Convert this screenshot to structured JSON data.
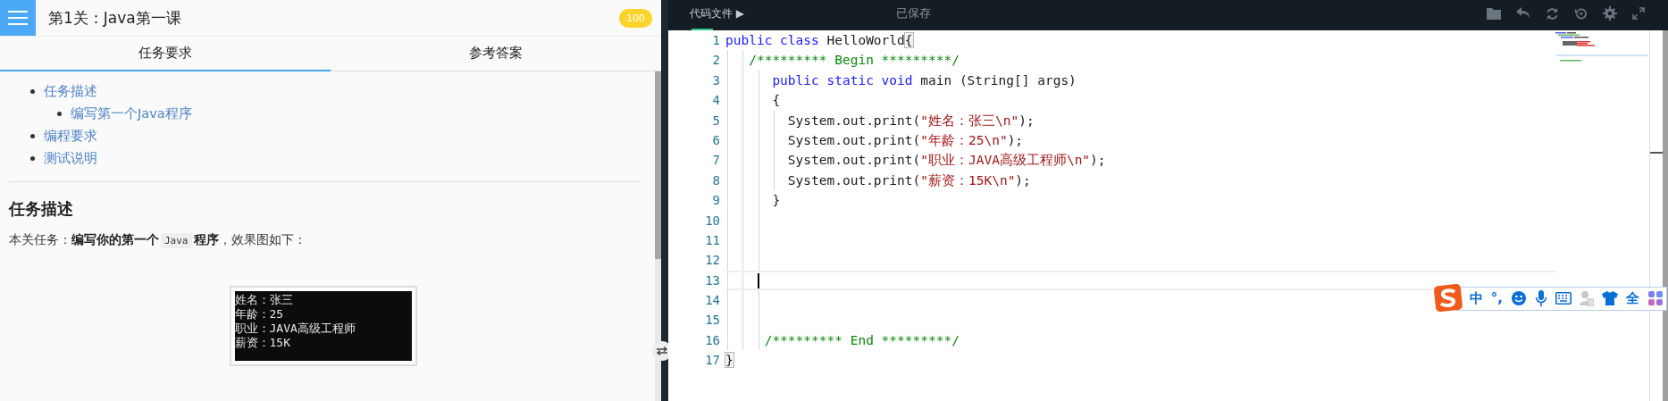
{
  "header": {
    "title": "第1关：Java第一课",
    "score": "100"
  },
  "tabs": [
    {
      "label": "任务要求",
      "selected": true
    },
    {
      "label": "参考答案",
      "selected": false
    }
  ],
  "toc": [
    {
      "label": "任务描述",
      "children": [
        {
          "label": "编写第一个Java程序"
        }
      ]
    },
    {
      "label": "编程要求"
    },
    {
      "label": "测试说明"
    }
  ],
  "section": {
    "heading": "任务描述",
    "paragraph": [
      {
        "kind": "text",
        "text": "本关任务："
      },
      {
        "kind": "bold",
        "text": "编写你的第一个"
      },
      {
        "kind": "code",
        "text": "Java"
      },
      {
        "kind": "bold",
        "text": "程序"
      },
      {
        "kind": "text",
        "text": "，效果图如下："
      }
    ]
  },
  "console_output": [
    "姓名：张三",
    "年龄：25",
    "职业：JAVA高级工程师",
    "薪资：15K"
  ],
  "editor": {
    "file_tab": "代码文件",
    "file_tab_arrow": "▶",
    "status": "已保存",
    "lines": [
      {
        "number": "1",
        "current": false,
        "tokens": [
          {
            "kind": "keyword",
            "text": "public class"
          },
          {
            "kind": "plain",
            "text": " HelloWorld"
          },
          {
            "kind": "match",
            "text": "{"
          }
        ]
      },
      {
        "number": "2",
        "current": false,
        "tokens": [
          {
            "kind": "comment",
            "text": "   /********* Begin *********/"
          }
        ]
      },
      {
        "number": "3",
        "current": false,
        "tokens": [
          {
            "kind": "keyword",
            "text": "      public static void"
          },
          {
            "kind": "plain",
            "text": " main (String[] args)"
          }
        ]
      },
      {
        "number": "4",
        "current": false,
        "tokens": [
          {
            "kind": "plain",
            "text": "      {"
          }
        ]
      },
      {
        "number": "5",
        "current": false,
        "tokens": [
          {
            "kind": "plain",
            "text": "        System.out.print("
          },
          {
            "kind": "string",
            "text": "\"姓名：张三\\n\""
          },
          {
            "kind": "plain",
            "text": ");"
          }
        ]
      },
      {
        "number": "6",
        "current": false,
        "tokens": [
          {
            "kind": "plain",
            "text": "        System.out.print("
          },
          {
            "kind": "string",
            "text": "\"年龄：25\\n\""
          },
          {
            "kind": "plain",
            "text": ");"
          }
        ]
      },
      {
        "number": "7",
        "current": false,
        "tokens": [
          {
            "kind": "plain",
            "text": "        System.out.print("
          },
          {
            "kind": "string",
            "text": "\"职业：JAVA高级工程师\\n\""
          },
          {
            "kind": "plain",
            "text": ");"
          }
        ]
      },
      {
        "number": "8",
        "current": false,
        "tokens": [
          {
            "kind": "plain",
            "text": "        System.out.print("
          },
          {
            "kind": "string",
            "text": "\"薪资：15K\\n\""
          },
          {
            "kind": "plain",
            "text": ");"
          }
        ]
      },
      {
        "number": "9",
        "current": false,
        "tokens": [
          {
            "kind": "plain",
            "text": "      }"
          }
        ]
      },
      {
        "number": "10",
        "current": false
      },
      {
        "number": "11",
        "current": false
      },
      {
        "number": "12",
        "current": false
      },
      {
        "number": "13",
        "current": true
      },
      {
        "number": "14",
        "current": false
      },
      {
        "number": "15",
        "current": false
      },
      {
        "number": "16",
        "current": false,
        "tokens": [
          {
            "kind": "comment",
            "text": "     /********* End *********/"
          }
        ]
      },
      {
        "number": "17",
        "current": false,
        "tokens": [
          {
            "kind": "match",
            "text": "}"
          }
        ]
      }
    ]
  },
  "ime_toolbar": {
    "language": "中",
    "punctuation": "°,",
    "width_mode": "全"
  }
}
